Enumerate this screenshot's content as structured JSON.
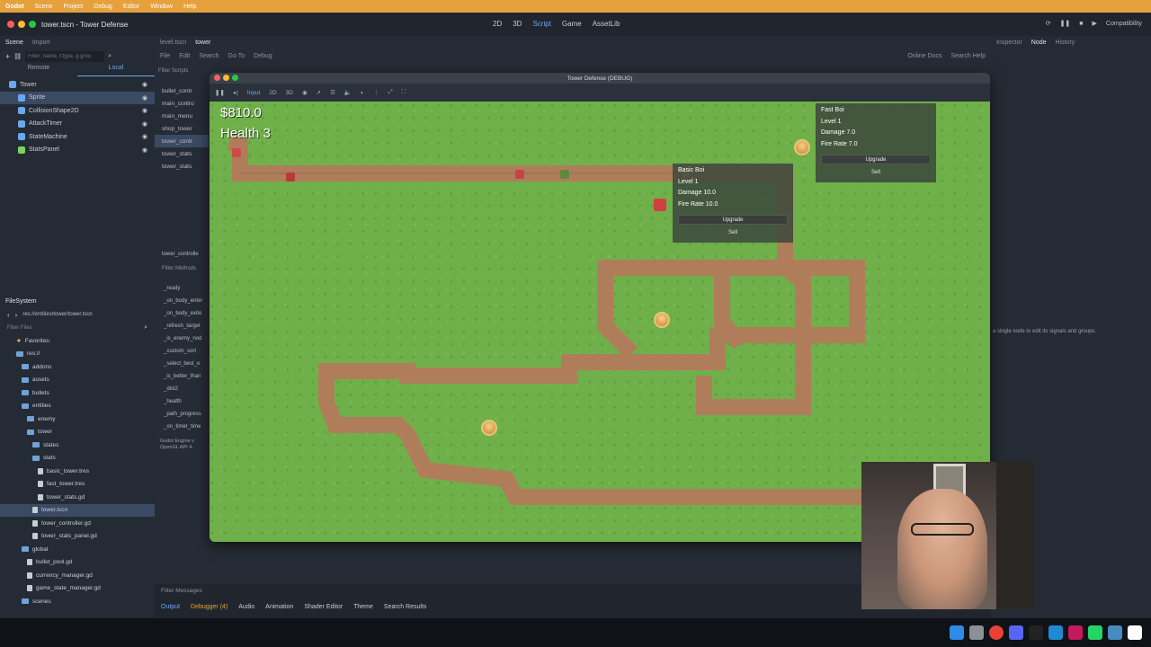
{
  "menubar": {
    "app": "Godot",
    "items": [
      "Scene",
      "Project",
      "Debug",
      "Editor",
      "Window",
      "Help"
    ]
  },
  "editor": {
    "title": "tower.tscn - Tower Defense",
    "workspaces": [
      "2D",
      "3D",
      "Script",
      "Game",
      "AssetLib"
    ],
    "active_workspace": "Script",
    "renderer": "Compatibility"
  },
  "scene_panel": {
    "tabs": [
      "Scene",
      "Import"
    ],
    "filter_placeholder": "Filter: name, t:type, g:grou",
    "remote_label": "Remote",
    "local_label": "Local",
    "nodes": [
      {
        "label": "Tower",
        "color": "#6aa8f0",
        "indent": 0
      },
      {
        "label": "Sprite",
        "color": "#6aa8f0",
        "indent": 1,
        "selected": true
      },
      {
        "label": "CollisionShape2D",
        "color": "#6aa8f0",
        "indent": 1
      },
      {
        "label": "AttackTimer",
        "color": "#6aa8f0",
        "indent": 1
      },
      {
        "label": "StateMachine",
        "color": "#6aa8f0",
        "indent": 1
      },
      {
        "label": "StatsPanel",
        "color": "#7ed35a",
        "indent": 1
      }
    ]
  },
  "filesystem": {
    "title": "FileSystem",
    "path": "res://entities/tower/tower.tscn",
    "filter_placeholder": "Filter Files",
    "items": [
      {
        "label": "Favorites:",
        "kind": "star",
        "indent": 0
      },
      {
        "label": "res://",
        "kind": "folder",
        "indent": 0
      },
      {
        "label": "addons",
        "kind": "folder",
        "indent": 1
      },
      {
        "label": "assets",
        "kind": "folder",
        "indent": 1
      },
      {
        "label": "bullets",
        "kind": "folder",
        "indent": 1
      },
      {
        "label": "entities",
        "kind": "folder",
        "indent": 1
      },
      {
        "label": "enemy",
        "kind": "folder",
        "indent": 2
      },
      {
        "label": "tower",
        "kind": "folder",
        "indent": 2
      },
      {
        "label": "states",
        "kind": "folder",
        "indent": 3
      },
      {
        "label": "stats",
        "kind": "folder",
        "indent": 3
      },
      {
        "label": "basic_tower.tres",
        "kind": "file",
        "indent": 4
      },
      {
        "label": "fast_tower.tres",
        "kind": "file",
        "indent": 4
      },
      {
        "label": "tower_stats.gd",
        "kind": "file",
        "indent": 4
      },
      {
        "label": "tower.tscn",
        "kind": "file",
        "indent": 3,
        "selected": true
      },
      {
        "label": "tower_controller.gd",
        "kind": "file",
        "indent": 3
      },
      {
        "label": "tower_stats_panel.gd",
        "kind": "file",
        "indent": 3
      },
      {
        "label": "global",
        "kind": "folder",
        "indent": 1
      },
      {
        "label": "bullet_pool.gd",
        "kind": "file",
        "indent": 2
      },
      {
        "label": "currency_manager.gd",
        "kind": "file",
        "indent": 2
      },
      {
        "label": "game_state_manager.gd",
        "kind": "file",
        "indent": 2
      },
      {
        "label": "scenes",
        "kind": "folder",
        "indent": 1
      }
    ]
  },
  "script_panel": {
    "menu": [
      "File",
      "Edit",
      "Search",
      "Go To",
      "Debug"
    ],
    "filter_scripts": "Filter Scripts",
    "open_tabs": [
      "level.tscn",
      "tower"
    ],
    "scripts": [
      "bullet_contr",
      "main_contro",
      "main_menu",
      "shop_tower",
      "tower_contr",
      "tower_stats",
      "tower_stats"
    ],
    "active_script_index": 4,
    "current": "tower_controlle",
    "filter_methods": "Filter Methods",
    "methods": [
      "_ready",
      "_on_body_enter",
      "_on_body_exite",
      "_refresh_target",
      "_is_enemy_nod",
      "_custom_sort",
      "_select_best_e",
      "_is_better_than",
      "_dist2",
      "_health",
      "_path_progress",
      "_on_timer_time"
    ],
    "console": [
      "Godot Engine v",
      "OpenGL API 4."
    ],
    "online_docs": "Online Docs",
    "search_help": "Search Help"
  },
  "inspector": {
    "tabs": [
      "Inspector",
      "Node",
      "History"
    ],
    "hint": "a single node to edit its signals and groups."
  },
  "game_window": {
    "title": "Tower Defense (DEBUG)",
    "toolbar": [
      "Input",
      "2D",
      "3D"
    ],
    "money": "$810.0",
    "health": "Health 3",
    "panel_fast": {
      "name": "Fast Boi",
      "level": "Level 1",
      "damage": "Damage 7.0",
      "fire_rate": "Fire Rate 7.0",
      "upgrade": "Upgrade",
      "sell": "Sell"
    },
    "panel_basic": {
      "name": "Basic Boi",
      "level": "Level 1",
      "damage": "Damage 10.0",
      "fire_rate": "Fire Rate 10.0",
      "upgrade": "Upgrade",
      "sell": "Sell"
    }
  },
  "bottom_panel": {
    "filter_messages": "Filter Messages",
    "tabs": [
      "Output",
      "Debugger (4)",
      "Audio",
      "Animation",
      "Shader Editor",
      "Theme",
      "Search Results"
    ]
  },
  "colors": {
    "accent": "#6aa8f0",
    "godot_orange": "#e6a13c",
    "grass": "#6fb04a",
    "path": "#b07d5b"
  }
}
